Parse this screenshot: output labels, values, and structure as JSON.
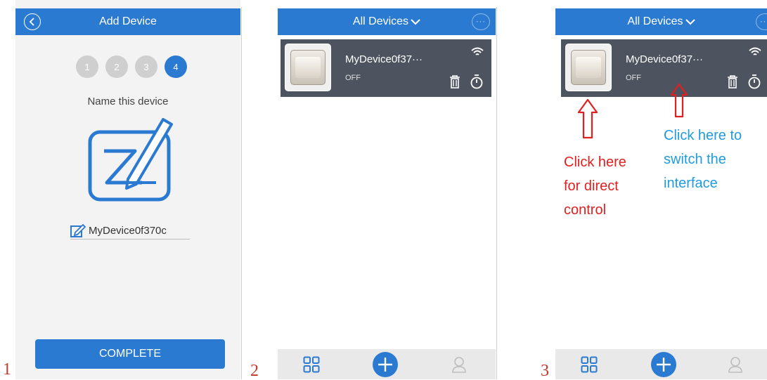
{
  "screen1": {
    "header_title": "Add Device",
    "steps": [
      "1",
      "2",
      "3",
      "4"
    ],
    "active_step": 4,
    "name_title": "Name this device",
    "device_name": "MyDevice0f370c",
    "complete_label": "COMPLETE",
    "caption_number": "1"
  },
  "screen2": {
    "header_title": "All Devices",
    "device": {
      "name": "MyDevice0f37···",
      "status": "OFF"
    },
    "caption_number": "2"
  },
  "screen3": {
    "header_title": "All Devices",
    "device": {
      "name": "MyDevice0f37···",
      "status": "OFF"
    },
    "note_direct": "Click here\nfor direct\ncontrol",
    "note_switch": "Click here to\nswitch the\ninterface",
    "caption_number": "3"
  },
  "icons": [
    "back-icon",
    "chevron-down-icon",
    "more-icon",
    "edit-icon",
    "name-device-icon",
    "switch-icon",
    "wifi-icon",
    "trash-icon",
    "timer-icon",
    "grid-icon",
    "add-icon",
    "user-icon",
    "arrow-up-icon"
  ],
  "colors": {
    "primary": "#2b7ad1",
    "card": "#4d545f",
    "annotation_red": "#e02020",
    "annotation_blue": "#1f9bde"
  }
}
